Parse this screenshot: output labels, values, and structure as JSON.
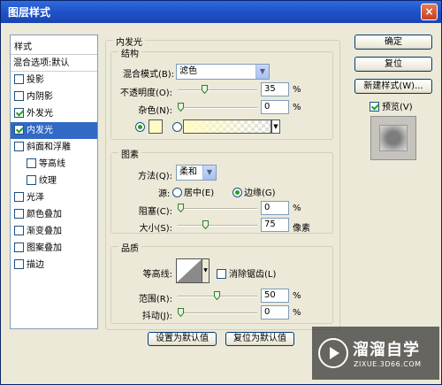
{
  "window": {
    "title": "图层样式",
    "close_glyph": "×"
  },
  "styles_panel": {
    "header": "样式",
    "blend_options": "混合选项:默认",
    "items": [
      {
        "label": "投影",
        "checked": false,
        "selected": false,
        "indent": false
      },
      {
        "label": "内阴影",
        "checked": false,
        "selected": false,
        "indent": false
      },
      {
        "label": "外发光",
        "checked": true,
        "selected": false,
        "indent": false
      },
      {
        "label": "内发光",
        "checked": true,
        "selected": true,
        "indent": false
      },
      {
        "label": "斜面和浮雕",
        "checked": false,
        "selected": false,
        "indent": false
      },
      {
        "label": "等高线",
        "checked": false,
        "selected": false,
        "indent": true
      },
      {
        "label": "纹理",
        "checked": false,
        "selected": false,
        "indent": true
      },
      {
        "label": "光泽",
        "checked": false,
        "selected": false,
        "indent": false
      },
      {
        "label": "颜色叠加",
        "checked": false,
        "selected": false,
        "indent": false
      },
      {
        "label": "渐变叠加",
        "checked": false,
        "selected": false,
        "indent": false
      },
      {
        "label": "图案叠加",
        "checked": false,
        "selected": false,
        "indent": false
      },
      {
        "label": "描边",
        "checked": false,
        "selected": false,
        "indent": false
      }
    ]
  },
  "inner_glow": {
    "title": "内发光",
    "structure": {
      "title": "结构",
      "blend_mode_label": "混合模式(B):",
      "blend_mode_value": "滤色",
      "opacity_label": "不透明度(O):",
      "opacity_value": "35",
      "opacity_unit": "%",
      "noise_label": "杂色(N):",
      "noise_value": "0",
      "noise_unit": "%",
      "color_swatch": "#fffbc6"
    },
    "elements": {
      "title": "图素",
      "technique_label": "方法(Q):",
      "technique_value": "柔和",
      "source_label": "源:",
      "source_center": "居中(E)",
      "source_edge": "边缘(G)",
      "choke_label": "阻塞(C):",
      "choke_value": "0",
      "choke_unit": "%",
      "size_label": "大小(S):",
      "size_value": "75",
      "size_unit": "像素"
    },
    "quality": {
      "title": "品质",
      "contour_label": "等高线:",
      "anti_alias_label": "消除锯齿(L)",
      "range_label": "范围(R):",
      "range_value": "50",
      "range_unit": "%",
      "jitter_label": "抖动(J):",
      "jitter_value": "0",
      "jitter_unit": "%"
    },
    "make_default": "设置为默认值",
    "reset_default": "复位为默认值"
  },
  "buttons": {
    "ok": "确定",
    "reset": "复位",
    "new_style": "新建样式(W)...",
    "preview_label": "预览(V)"
  },
  "watermark": {
    "brand": "溜溜自学",
    "url": "ZIXUE.3D66.COM"
  }
}
